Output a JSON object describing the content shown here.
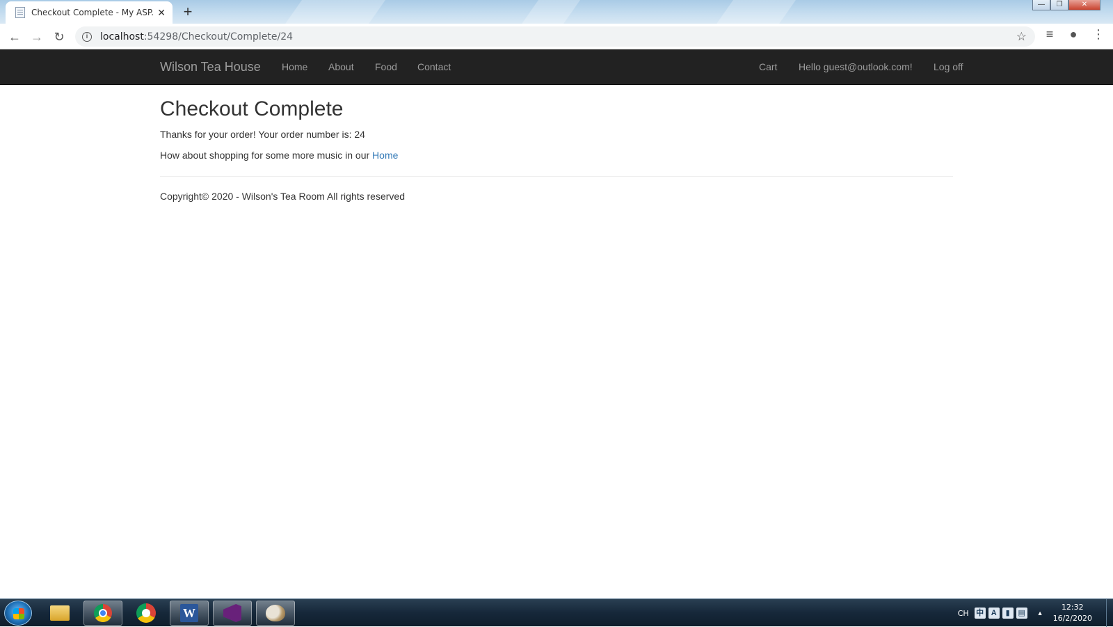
{
  "browser": {
    "tab_title": "Checkout Complete - My ASP.NET Application",
    "url_host": "localhost",
    "url_path": ":54298/Checkout/Complete/24",
    "icons": {
      "back": "arrow-left-icon",
      "forward": "arrow-right-icon",
      "reload": "reload-icon",
      "info": "info-icon",
      "bookmark": "star-icon",
      "media": "media-queue-icon",
      "profile": "account-icon",
      "menu": "kebab-menu-icon"
    }
  },
  "navbar": {
    "brand": "Wilson Tea House",
    "links": [
      "Home",
      "About",
      "Food",
      "Contact"
    ],
    "right_links": [
      "Cart",
      "Hello guest@outlook.com!",
      "Log off"
    ],
    "background": "#222222",
    "link_color": "#9d9d9d"
  },
  "main": {
    "title": "Checkout Complete",
    "thanks_text": "Thanks for your order! Your order number is: 24",
    "shopping_text": "How about shopping for some more music in our ",
    "home_link": "Home",
    "footer": "Copyright© 2020 - Wilson's Tea Room All rights reserved",
    "link_color": "#337ab7"
  },
  "taskbar": {
    "apps": [
      "start",
      "windows-explorer",
      "google-chrome",
      "chrome-app",
      "microsoft-word",
      "visual-studio",
      "paint"
    ],
    "language": "CH",
    "time": "12:32",
    "date": "16/2/2020"
  }
}
